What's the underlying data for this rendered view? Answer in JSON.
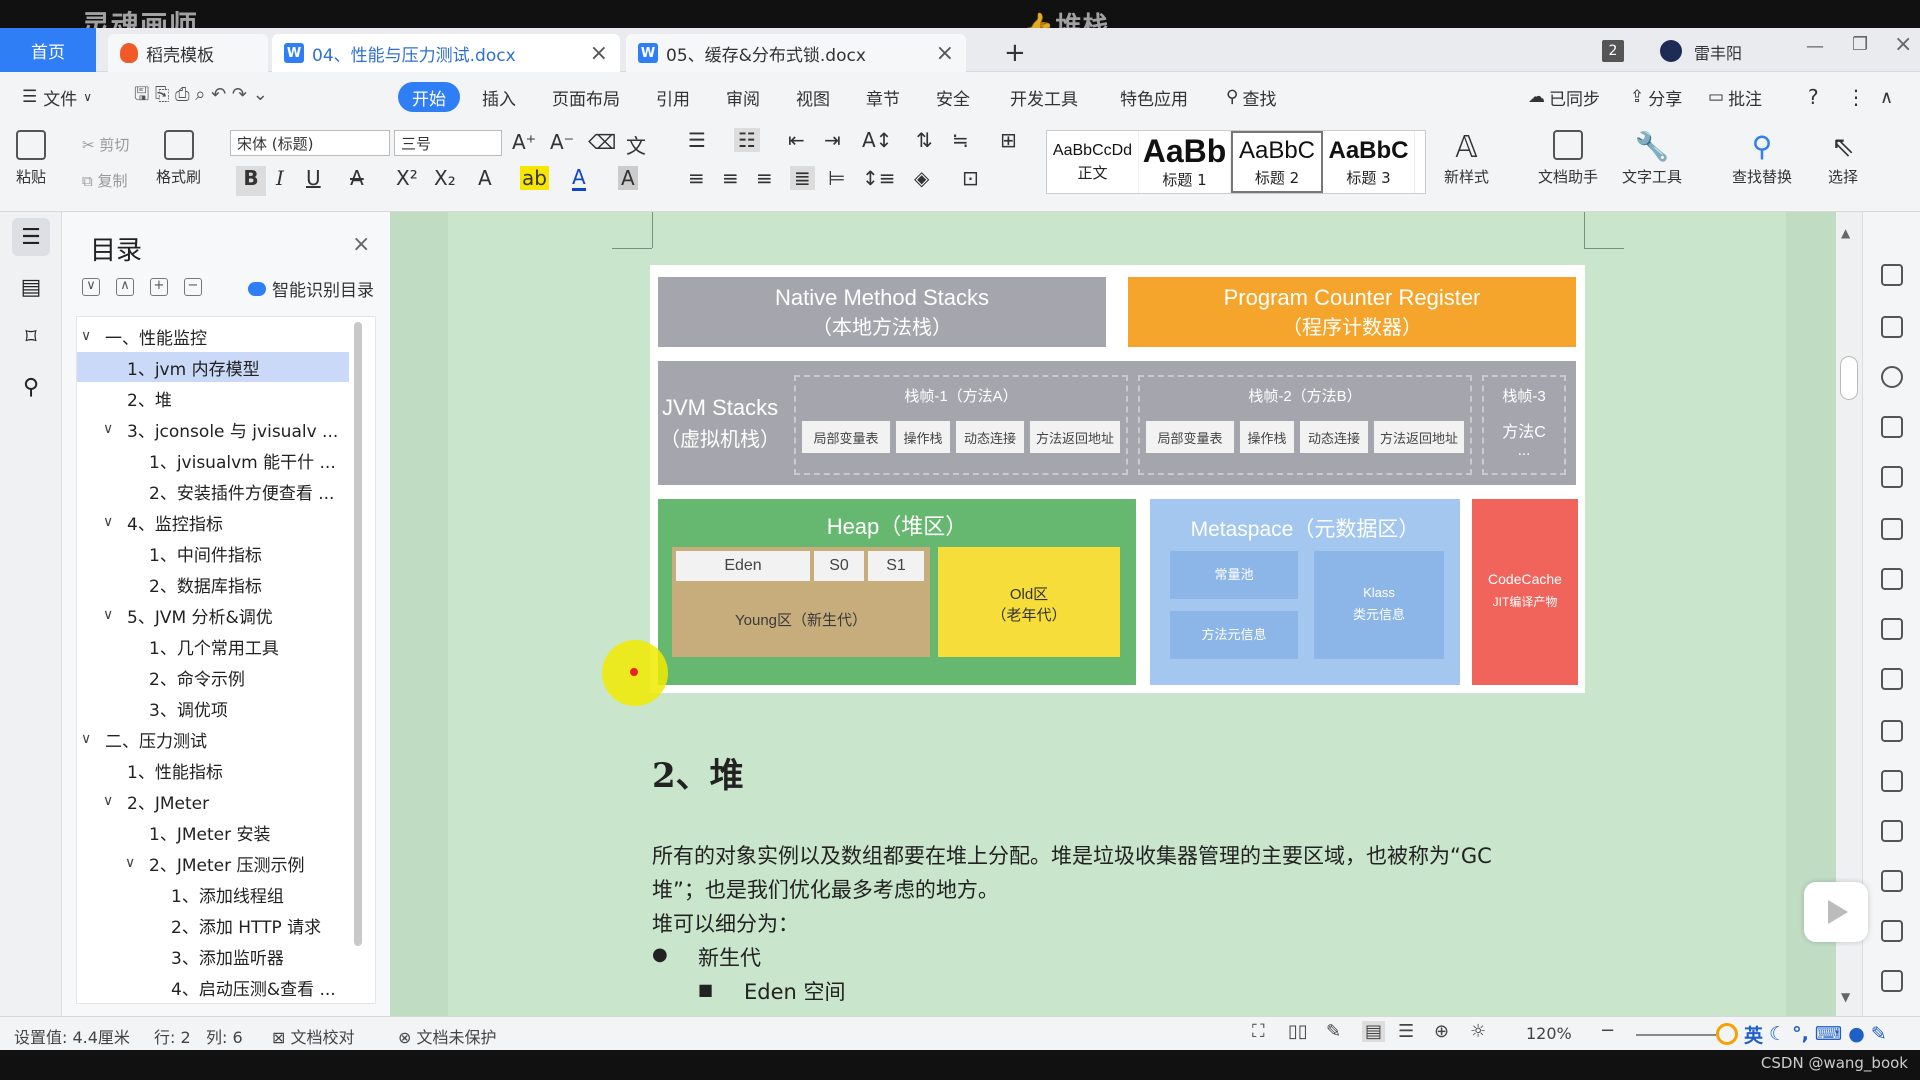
{
  "watermarks": {
    "left": "灵魂画师",
    "center": "👍堆栈"
  },
  "tabs": {
    "home": "首页",
    "items": [
      {
        "label": "稻壳模板"
      },
      {
        "label": "04、性能与压力测试.docx"
      },
      {
        "label": "05、缓存&分布式锁.docx"
      }
    ],
    "add": "+",
    "badge": "2",
    "user": "雷丰阳"
  },
  "menu": {
    "file": "文件",
    "items": [
      "开始",
      "插入",
      "页面布局",
      "引用",
      "审阅",
      "视图",
      "章节",
      "安全",
      "开发工具",
      "特色应用"
    ],
    "search": "查找",
    "synced": "已同步",
    "share": "分享",
    "comment": "批注"
  },
  "ribbon": {
    "paste": "粘贴",
    "cut": "剪切",
    "copy": "复制",
    "format_painter": "格式刷",
    "font_name": "宋体 (标题)",
    "font_size": "三号",
    "styles": [
      {
        "preview": "AaBbCcDd",
        "label": "正文"
      },
      {
        "preview": "AaBb",
        "label": "标题 1"
      },
      {
        "preview": "AaBbC",
        "label": "标题 2"
      },
      {
        "preview": "AaBbC",
        "label": "标题 3"
      }
    ],
    "new_style": "新样式",
    "doc_assistant": "文档助手",
    "text_tools": "文字工具",
    "find_replace": "查找替换",
    "select": "选择"
  },
  "toc": {
    "title": "目录",
    "smart": "智能识别目录",
    "items": [
      {
        "text": "一、性能监控",
        "level": 0,
        "chev": "∨"
      },
      {
        "text": "1、jvm 内存模型",
        "level": 1,
        "chev": ""
      },
      {
        "text": "2、堆",
        "level": 1,
        "chev": ""
      },
      {
        "text": "3、jconsole 与 jvisualv ...",
        "level": 1,
        "chev": "∨"
      },
      {
        "text": "1、jvisualvm 能干什 ...",
        "level": 2,
        "chev": ""
      },
      {
        "text": "2、安装插件方便查看 ...",
        "level": 2,
        "chev": ""
      },
      {
        "text": "4、监控指标",
        "level": 1,
        "chev": "∨"
      },
      {
        "text": "1、中间件指标",
        "level": 2,
        "chev": ""
      },
      {
        "text": "2、数据库指标",
        "level": 2,
        "chev": ""
      },
      {
        "text": "5、JVM 分析&调优",
        "level": 1,
        "chev": "∨"
      },
      {
        "text": "1、几个常用工具",
        "level": 2,
        "chev": ""
      },
      {
        "text": "2、命令示例",
        "level": 2,
        "chev": ""
      },
      {
        "text": "3、调优项",
        "level": 2,
        "chev": ""
      },
      {
        "text": "二、压力测试",
        "level": 0,
        "chev": "∨"
      },
      {
        "text": "1、性能指标",
        "level": 1,
        "chev": ""
      },
      {
        "text": "2、JMeter",
        "level": 1,
        "chev": "∨"
      },
      {
        "text": "1、JMeter 安装",
        "level": 2,
        "chev": ""
      },
      {
        "text": "2、JMeter 压测示例",
        "level": 2,
        "chev": "∨"
      },
      {
        "text": "1、添加线程组",
        "level": 3,
        "chev": ""
      },
      {
        "text": "2、添加 HTTP 请求",
        "level": 3,
        "chev": ""
      },
      {
        "text": "3、添加监听器",
        "level": 3,
        "chev": ""
      },
      {
        "text": "4、启动压测&查看 ...",
        "level": 3,
        "chev": ""
      }
    ]
  },
  "diagram": {
    "native": {
      "en": "Native Method Stacks",
      "cn": "（本地方法栈）"
    },
    "pc": {
      "en": "Program Counter Register",
      "cn": "（程序计数器）"
    },
    "jvm": {
      "en": "JVM Stacks",
      "cn": "（虚拟机栈）"
    },
    "frame1": "栈帧-1（方法A）",
    "frame2": "栈帧-2（方法B）",
    "frame3": "栈帧-3",
    "frame3_method": "方法C",
    "ellipsis": "...",
    "cells": [
      "局部变量表",
      "操作栈",
      "动态连接",
      "方法返回地址"
    ],
    "heap": "Heap（堆区）",
    "eden": "Eden",
    "s0": "S0",
    "s1": "S1",
    "young": "Young区（新生代）",
    "old": "Old区",
    "old_sub": "（老年代）",
    "meta": "Metaspace（元数据区）",
    "meta_const": "常量池",
    "meta_method": "方法元信息",
    "klass": "Klass",
    "klass_sub": "类元信息",
    "codecache": "CodeCache",
    "codecache_sub": "JIT编译产物"
  },
  "doc": {
    "heading": "2、堆",
    "para1": "所有的对象实例以及数组都要在堆上分配。堆是垃圾收集器管理的主要区域，也被称为“GC",
    "para2": "堆”；也是我们优化最多考虑的地方。",
    "para3": "堆可以细分为：",
    "bullet1": "新生代",
    "bullet2": "Eden 空间",
    "bullet1_mark": "●",
    "bullet2_mark": "■"
  },
  "status": {
    "setting": "设置值: 4.4厘米",
    "row": "行: 2",
    "col": "列: 6",
    "proof": "文档校对",
    "protect": "文档未保护",
    "zoom": "120%",
    "ime": "英"
  },
  "footer": {
    "csdn": "CSDN @wang_book"
  },
  "colors": {
    "accent": "#2f7ef5",
    "page_bg": "#c9e5cb"
  }
}
